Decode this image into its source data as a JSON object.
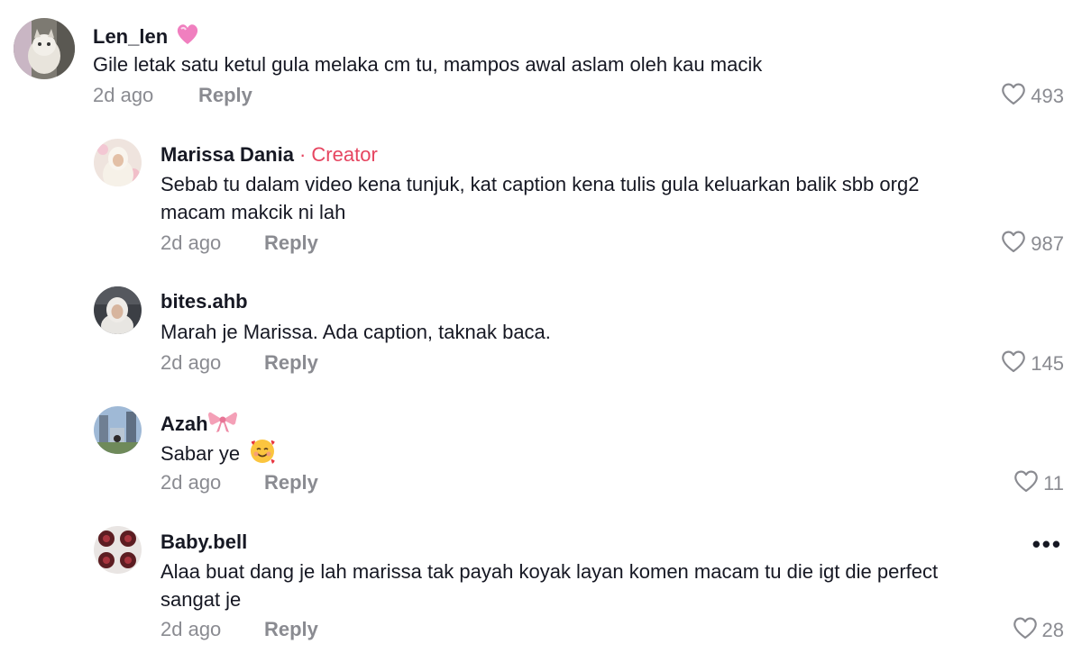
{
  "comments": [
    {
      "username": "Len_len",
      "text_lines": [
        "Gile letak satu ketul gula melaka cm tu, mampos awal aslam oleh kau macik"
      ],
      "time": "2d ago",
      "reply_label": "Reply",
      "likes": "493",
      "badge_icon": "pink-heart-icon"
    },
    {
      "username": "Marissa Dania",
      "creator_label": "· Creator",
      "text_lines": [
        "Sebab tu dalam video kena tunjuk, kat caption kena tulis gula keluarkan balik sbb org2",
        "macam makcik ni lah"
      ],
      "time": "2d ago",
      "reply_label": "Reply",
      "likes": "987"
    },
    {
      "username": "bites.ahb",
      "text_lines": [
        "Marah je Marissa. Ada caption, taknak baca."
      ],
      "time": "2d ago",
      "reply_label": "Reply",
      "likes": "145"
    },
    {
      "username": "Azah",
      "badge_icon": "ribbon-icon",
      "text_lines": [
        "Sabar ye"
      ],
      "text_emoji": "smiling-face-with-hearts-icon",
      "time": "2d ago",
      "reply_label": "Reply",
      "likes": "11"
    },
    {
      "username": "Baby.bell",
      "text_lines": [
        "Alaa buat dang je lah marissa tak payah koyak layan komen macam tu die igt die perfect",
        "sangat je"
      ],
      "time": "2d ago",
      "reply_label": "Reply",
      "likes": "28",
      "more_label": "•••"
    }
  ],
  "colors": {
    "text": "#161823",
    "secondary": "#8a8b91",
    "creator": "#e64560",
    "background": "#ffffff"
  }
}
